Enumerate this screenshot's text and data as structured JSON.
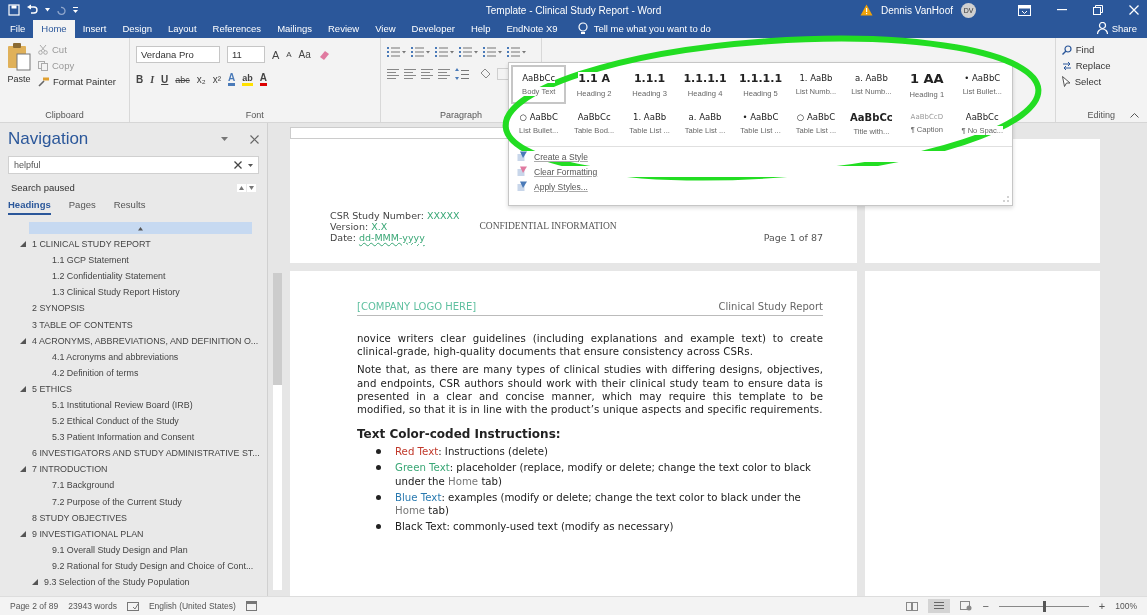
{
  "window": {
    "title": "Template - Clinical Study Report  -  Word",
    "user": "Dennis VanHoof",
    "avatar_initials": "DV"
  },
  "ribbon_tabs": [
    {
      "label": "File",
      "selected": false
    },
    {
      "label": "Home",
      "selected": true
    },
    {
      "label": "Insert",
      "selected": false
    },
    {
      "label": "Design",
      "selected": false
    },
    {
      "label": "Layout",
      "selected": false
    },
    {
      "label": "References",
      "selected": false
    },
    {
      "label": "Mailings",
      "selected": false
    },
    {
      "label": "Review",
      "selected": false
    },
    {
      "label": "View",
      "selected": false
    },
    {
      "label": "Developer",
      "selected": false
    },
    {
      "label": "Help",
      "selected": false
    },
    {
      "label": "EndNote X9",
      "selected": false
    }
  ],
  "tell_me": {
    "placeholder": "Tell me what you want to do"
  },
  "share": "Share",
  "clipboard": {
    "paste": "Paste",
    "items": [
      "Cut",
      "Copy",
      "Format Painter"
    ],
    "label": "Clipboard"
  },
  "font": {
    "family": "Verdana Pro",
    "size": "11",
    "size_buttons": [
      "A",
      "A"
    ],
    "change_case": "Aa",
    "format_buttons": [
      "B",
      "I",
      "U",
      "abc",
      "x₂",
      "x²"
    ],
    "color_buttons": [
      "A",
      "ab",
      "A"
    ],
    "label": "Font"
  },
  "paragraph": {
    "label": "Paragraph"
  },
  "style_gallery": {
    "styles": [
      {
        "sample": "AaBbCc",
        "name": "Body Text",
        "kind": "body",
        "selected": true
      },
      {
        "sample": "1.1 A",
        "name": "Heading 2",
        "kind": "heading",
        "selected": false
      },
      {
        "sample": "1.1.1",
        "name": "Heading 3",
        "kind": "heading",
        "selected": false
      },
      {
        "sample": "1.1.1.1",
        "name": "Heading 4",
        "kind": "heading",
        "selected": false
      },
      {
        "sample": "1.1.1.1",
        "name": "Heading 5",
        "kind": "heading",
        "selected": false
      },
      {
        "sample": "1. AaBb",
        "name": "List Numb...",
        "kind": "body",
        "selected": false
      },
      {
        "sample": "a. AaBb",
        "name": "List Numb...",
        "kind": "body",
        "selected": false
      },
      {
        "sample": "1 AA",
        "name": "Heading 1",
        "kind": "title",
        "selected": false
      },
      {
        "sample": "• AaBbC",
        "name": "List Bullet...",
        "kind": "body",
        "selected": false
      },
      {
        "sample": "○ AaBbC",
        "name": "List Bullet...",
        "kind": "body",
        "selected": false
      },
      {
        "sample": "AaBbCc",
        "name": "Table Bod...",
        "kind": "body",
        "selected": false
      },
      {
        "sample": "1. AaBb",
        "name": "Table List ...",
        "kind": "body",
        "selected": false
      },
      {
        "sample": "a. AaBb",
        "name": "Table List ...",
        "kind": "body",
        "selected": false
      },
      {
        "sample": "• AaBbC",
        "name": "Table List ...",
        "kind": "body",
        "selected": false
      },
      {
        "sample": "○ AaBbC",
        "name": "Table List ...",
        "kind": "body",
        "selected": false
      },
      {
        "sample": "AaBbCc",
        "name": "Title with...",
        "kind": "subtitle",
        "selected": false
      },
      {
        "sample": "AaBbCcD",
        "name": "¶ Caption",
        "kind": "caption",
        "selected": false
      },
      {
        "sample": "AaBbCc",
        "name": "¶ No Spac...",
        "kind": "body",
        "selected": false
      }
    ],
    "menu": [
      "Create a Style",
      "Clear Formatting",
      "Apply Styles..."
    ]
  },
  "editing": {
    "items": [
      "Find",
      "Replace",
      "Select"
    ],
    "label": "Editing"
  },
  "navigation": {
    "title": "Navigation",
    "search": {
      "value": "helpful"
    },
    "status": "Search paused",
    "tabs": [
      {
        "label": "Headings",
        "selected": true
      },
      {
        "label": "Pages",
        "selected": false
      },
      {
        "label": "Results",
        "selected": false
      }
    ],
    "headings": [
      {
        "label": "1 CLINICAL STUDY REPORT",
        "expanded": true,
        "children": [
          {
            "label": "1.1 GCP Statement"
          },
          {
            "label": "1.2 Confidentiality Statement"
          },
          {
            "label": "1.3 Clinical Study Report History"
          }
        ]
      },
      {
        "label": "2 SYNOPSIS"
      },
      {
        "label": "3 TABLE OF CONTENTS"
      },
      {
        "label": "4 ACRONYMS, ABBREVIATIONS, AND DEFINITION O...",
        "expanded": true,
        "children": [
          {
            "label": "4.1 Acronyms and abbreviations"
          },
          {
            "label": "4.2 Definition of terms"
          }
        ]
      },
      {
        "label": "5 ETHICS",
        "expanded": true,
        "children": [
          {
            "label": "5.1 Institutional Review Board (IRB)"
          },
          {
            "label": "5.2 Ethical Conduct of the Study"
          },
          {
            "label": "5.3 Patient Information and Consent"
          }
        ]
      },
      {
        "label": "6 INVESTIGATORS AND STUDY ADMINISTRATIVE ST..."
      },
      {
        "label": "7 INTRODUCTION",
        "expanded": true,
        "children": [
          {
            "label": "7.1 Background"
          },
          {
            "label": "7.2 Purpose of the Current Study"
          }
        ]
      },
      {
        "label": "8 STUDY OBJECTIVES"
      },
      {
        "label": "9 INVESTIGATIONAL PLAN",
        "expanded": true,
        "children": [
          {
            "label": "9.1 Overall Study Design and Plan"
          },
          {
            "label": "9.2 Rational for Study Design and Choice of Cont..."
          },
          {
            "label": "9.3 Selection of the Study Population",
            "expanded": true
          }
        ]
      }
    ]
  },
  "document": {
    "page_1": {
      "fields": [
        [
          {
            "text": "CSR Study Number: ",
            "kind": "label"
          },
          {
            "text": "XXXXX",
            "kind": "placeholder"
          }
        ],
        [
          {
            "text": "Version: ",
            "kind": "label"
          },
          {
            "text": "X.X",
            "kind": "placeholder"
          }
        ],
        [
          {
            "text": "Date: ",
            "kind": "label"
          },
          {
            "text": "dd-MMM-yyyy",
            "kind": "placeholder"
          }
        ]
      ],
      "confidential": "CONFIDENTIAL INFORMATION",
      "page": "Page 1 of 87"
    },
    "page_2": {
      "header_left": "[COMPANY LOGO HERE]",
      "header_right": "Clinical Study Report",
      "paragraphs": [
        "novice writers clear guidelines (including explanations and example text) to create clinical-grade, high-quality documents that ensure consistency across CSRs.",
        "Note that, as there are many types of clinical studies with differing designs, objectives, and endpoints, CSR authors should work with their clinical study team to ensure data is presented in a clear and concise manner, which may require this template to be modified, so that it is in line with the product’s unique aspects and specific requirements."
      ],
      "heading": "Text Color-coded Instructions:",
      "bullets": [
        [
          {
            "text": "Red Text",
            "kind": "instruction"
          },
          {
            "text": ": Instructions (delete)",
            "kind": "plain"
          }
        ],
        [
          {
            "text": "Green Text",
            "kind": "placeholder"
          },
          {
            "text": ": placeholder (replace, modify or delete; change the text color to black under the ",
            "kind": "plain"
          },
          {
            "text": "Home",
            "kind": "ui"
          },
          {
            "text": " tab)",
            "kind": "plain"
          }
        ],
        [
          {
            "text": "Blue Text",
            "kind": "example"
          },
          {
            "text": ": examples (modify or delete; change the text color to black under the ",
            "kind": "plain"
          },
          {
            "text": "Home",
            "kind": "ui"
          },
          {
            "text": " tab)",
            "kind": "plain"
          }
        ],
        [
          {
            "text": "Black Text: commonly-used text (modify as necessary)",
            "kind": "plain"
          }
        ]
      ]
    }
  },
  "status_bar": {
    "page": "Page 2 of 89",
    "words": "23943 words",
    "language": "English (United States)",
    "zoom": {
      "out": "−",
      "in": "+",
      "level": 0.5,
      "reading": "100%"
    }
  }
}
